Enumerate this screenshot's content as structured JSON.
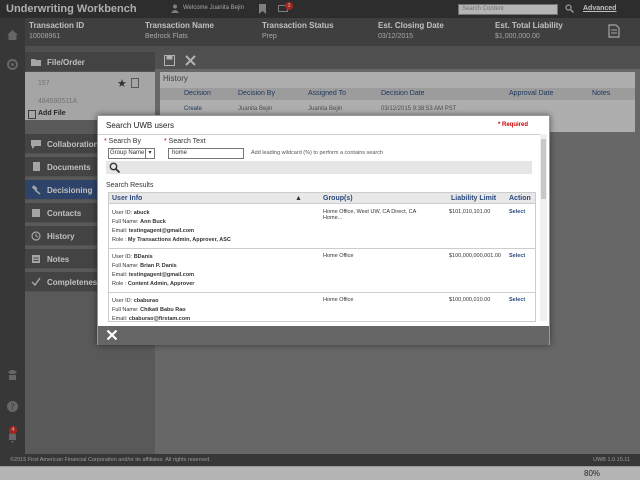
{
  "app": {
    "title": "Underwriting Workbench",
    "welcome": "Welcome Juanita Bejin",
    "mail_count": "3",
    "search_placeholder": "Search Content",
    "advanced": "Advanced"
  },
  "transaction": {
    "id_label": "Transaction ID",
    "id_value": "10008961",
    "name_label": "Transaction Name",
    "name_value": "Bedrock Flats",
    "status_label": "Transaction Status",
    "status_value": "Prep",
    "closing_label": "Est. Closing Date",
    "closing_value": "03/12/2015",
    "liability_label": "Est. Total Liability",
    "liability_value": "$1,000,000.00"
  },
  "sidebar": {
    "file_order": "File/Order",
    "file_num1": "157",
    "file_num2": "484590511A",
    "add_file": "Add File",
    "items": [
      "Collaboration",
      "Documents",
      "Decisioning",
      "Contacts",
      "History",
      "Notes",
      "Completeness"
    ],
    "notification_count": "4"
  },
  "history": {
    "title": "History",
    "columns": [
      "Decision",
      "Decision By",
      "Assigned To",
      "Decision Date",
      "Approval Date",
      "Notes"
    ],
    "row": {
      "decision": "Create",
      "by": "Juanita Bejin",
      "assigned": "Juanita Bejin",
      "date": "03/12/2015 9:38:53 AM PST"
    }
  },
  "modal": {
    "title": "Search UWB users",
    "required": "* Required",
    "search_by_label": "Search By",
    "search_by_value": "Group Name",
    "search_text_label": "Search Text",
    "search_text_value": "home",
    "hint": "Add leading wildcard (%) to perform a contains search",
    "results_title": "Search Results",
    "columns": {
      "user": "User Info",
      "groups": "Group(s)",
      "limit": "Liability Limit",
      "action": "Action"
    },
    "rows": [
      {
        "user_id": "abuck",
        "full_name": "Ann Buck",
        "email": "testingagent@gmail.com",
        "role": "My Transactions Admin, Approver, ASC",
        "groups": "Home Office, West UW, CA Direct, CA Home...",
        "limit": "$101,010,101.00",
        "action": "Select"
      },
      {
        "user_id": "BDanis",
        "full_name": "Brian P. Danis",
        "email": "testingagent@gmail.com",
        "role": "Content Admin, Approver",
        "groups": "Home Office",
        "limit": "$100,000,000,001.00",
        "action": "Select"
      },
      {
        "user_id": "cbaburao",
        "full_name": "Chikati Babu Rao",
        "email": "cbaburao@firstam.com",
        "role": "",
        "groups": "Home Office",
        "limit": "$100,000,010.00",
        "action": "Select"
      }
    ],
    "labels": {
      "user_id": "User ID: ",
      "full_name": "Full Name: ",
      "email": "Email: ",
      "role": "Role : "
    }
  },
  "footer": {
    "copyright": "©2015 First American Financial Corporation and/or its affiliates. All rights reserved.",
    "version": "UWB 1.0.15.11",
    "zoom": "80%"
  }
}
